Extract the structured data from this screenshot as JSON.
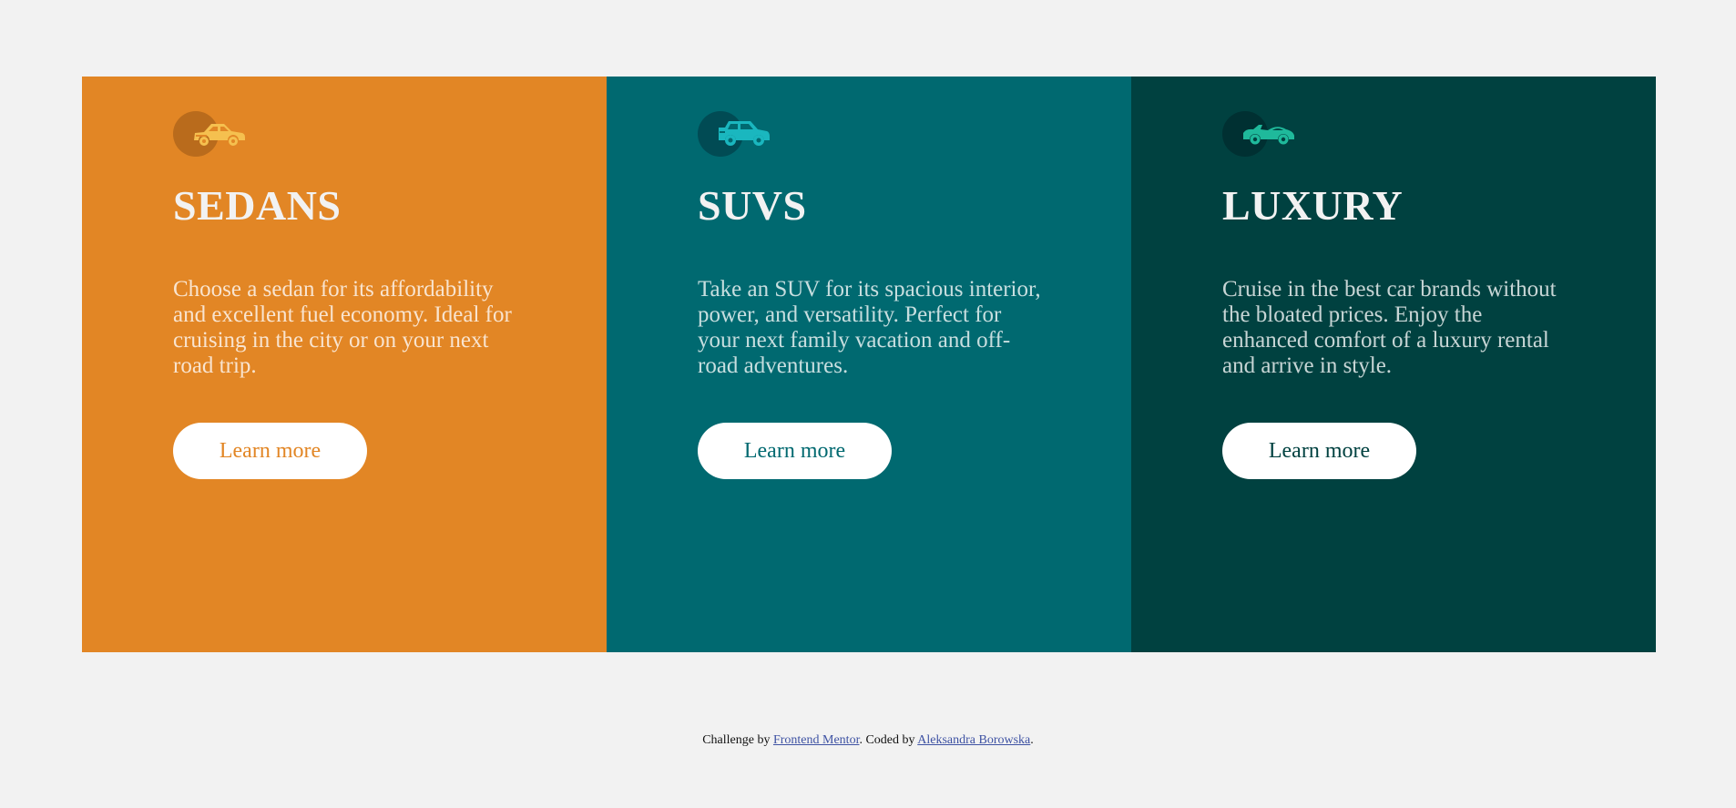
{
  "cards": [
    {
      "icon": "sedan-car-icon",
      "icon_color": "#f5c04f",
      "title": "SEDANS",
      "text": "Choose a sedan for its affordability and excellent fuel economy. Ideal for cruising in the city or on your next road trip.",
      "button_label": "Learn more",
      "background": "#e28625"
    },
    {
      "icon": "suv-car-icon",
      "icon_color": "#1ab7bf",
      "title": "SUVS",
      "text": "Take an SUV for its spacious interior, power, and versatility. Perfect for your next family vacation and off-road adventures.",
      "button_label": "Learn more",
      "background": "#006970"
    },
    {
      "icon": "luxury-car-icon",
      "icon_color": "#1fb99b",
      "title": "LUXURY",
      "text": "Cruise in the best car brands without the bloated prices. Enjoy the enhanced comfort of a luxury rental and arrive in style.",
      "button_label": "Learn more",
      "background": "#004140"
    }
  ],
  "attribution": {
    "prefix": "Challenge by ",
    "link1": "Frontend Mentor",
    "middle": ". Coded by ",
    "link2": "Aleksandra Borowska",
    "suffix": "."
  }
}
